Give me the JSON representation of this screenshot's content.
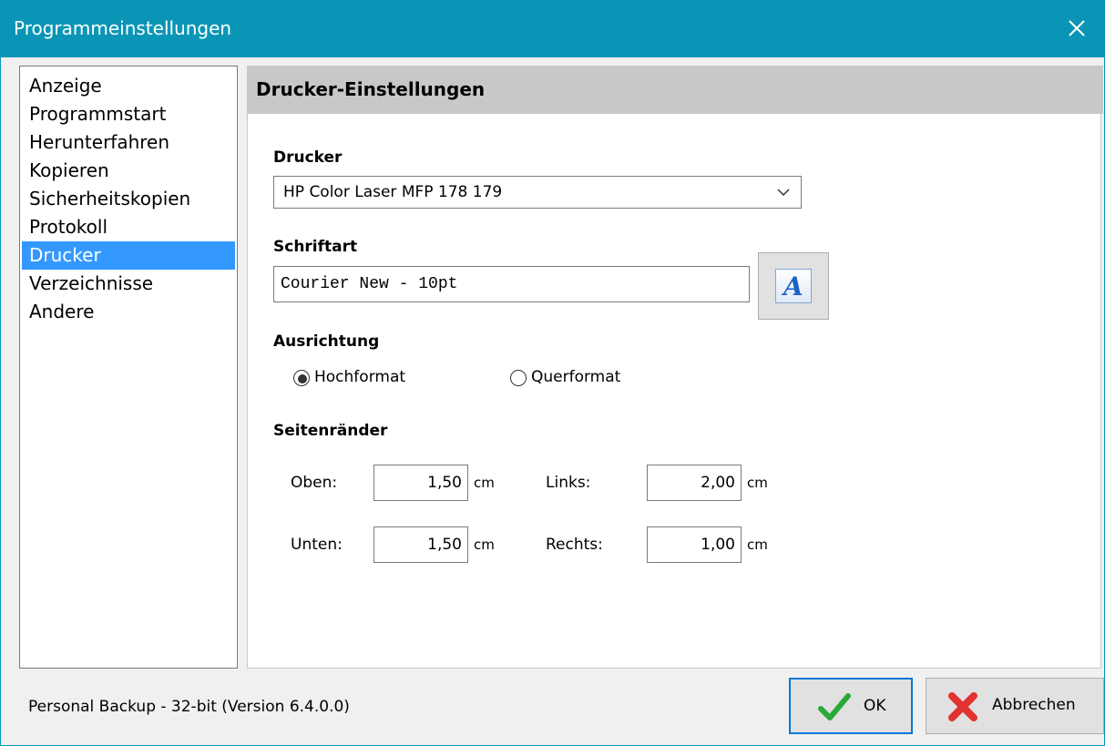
{
  "window": {
    "title": "Programmeinstellungen"
  },
  "nav": {
    "items": [
      {
        "label": "Anzeige",
        "selected": false
      },
      {
        "label": "Programmstart",
        "selected": false
      },
      {
        "label": "Herunterfahren",
        "selected": false
      },
      {
        "label": "Kopieren",
        "selected": false
      },
      {
        "label": "Sicherheitskopien",
        "selected": false
      },
      {
        "label": "Protokoll",
        "selected": false
      },
      {
        "label": "Drucker",
        "selected": true
      },
      {
        "label": "Verzeichnisse",
        "selected": false
      },
      {
        "label": "Andere",
        "selected": false
      }
    ]
  },
  "panel": {
    "title": "Drucker-Einstellungen",
    "printer": {
      "label": "Drucker",
      "value": "HP Color Laser MFP 178 179"
    },
    "font": {
      "label": "Schriftart",
      "value": "Courier New - 10pt",
      "button_glyph": "A"
    },
    "orientation": {
      "label": "Ausrichtung",
      "options": [
        {
          "label": "Hochformat",
          "selected": true
        },
        {
          "label": "Querformat",
          "selected": false
        }
      ]
    },
    "margins": {
      "label": "Seitenränder",
      "unit": "cm",
      "top": {
        "label": "Oben:",
        "value": "1,50"
      },
      "left": {
        "label": "Links:",
        "value": "2,00"
      },
      "bottom": {
        "label": "Unten:",
        "value": "1,50"
      },
      "right": {
        "label": "Rechts:",
        "value": "1,00"
      }
    }
  },
  "footer": {
    "version_text": "Personal Backup - 32-bit (Version 6.4.0.0)",
    "ok_label": "OK",
    "cancel_label": "Abbrechen"
  },
  "colors": {
    "titlebar": "#0a95b6",
    "selection": "#3399ff",
    "ok_check": "#2aa83a",
    "cancel_x": "#e0322f",
    "default_button_border": "#0078d7"
  }
}
